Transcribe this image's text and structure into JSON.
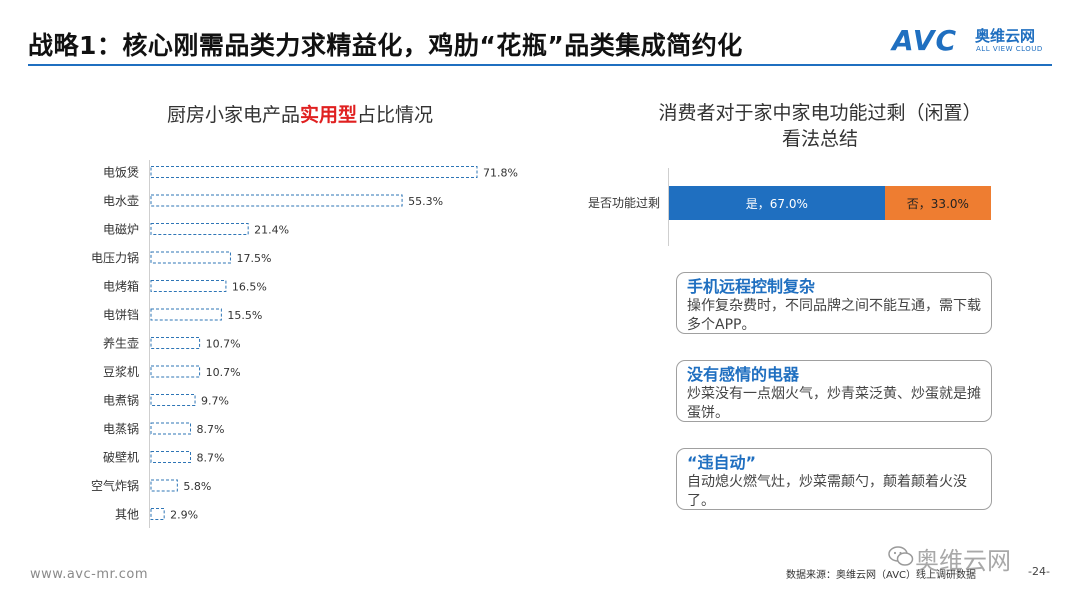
{
  "header": {
    "title": "战略1：核心刚需品类力求精益化，鸡肋“花瓶”品类集成简约化",
    "logo_text": "AVC",
    "logo_cn": "奥维云网",
    "logo_en": "ALL VIEW CLOUD",
    "accent_color": "#1f6fc0"
  },
  "left_chart": {
    "title_pre": "厨房小家电产品",
    "title_highlight": "实用型",
    "title_post": "占比情况"
  },
  "chart_data": [
    {
      "type": "bar",
      "orientation": "horizontal",
      "categories": [
        "电饭煲",
        "电水壶",
        "电磁炉",
        "电压力锅",
        "电烤箱",
        "电饼铛",
        "养生壶",
        "豆浆机",
        "电煮锅",
        "电蒸锅",
        "破壁机",
        "空气炸锅",
        "其他"
      ],
      "values": [
        71.8,
        55.3,
        21.4,
        17.5,
        16.5,
        15.5,
        10.7,
        10.7,
        9.7,
        8.7,
        8.7,
        5.8,
        2.9
      ],
      "value_labels": [
        "71.8%",
        "55.3%",
        "21.4%",
        "17.5%",
        "16.5%",
        "15.5%",
        "10.7%",
        "10.7%",
        "9.7%",
        "8.7%",
        "8.7%",
        "5.8%",
        "2.9%"
      ],
      "bar_style": "dashed-outline",
      "bar_color": "#2e75b6",
      "title": "厨房小家电产品实用型占比情况"
    },
    {
      "type": "bar",
      "orientation": "horizontal-stacked-100",
      "categories": [
        "是否功能过剩"
      ],
      "series": [
        {
          "name": "是",
          "values": [
            67.0
          ],
          "label": "是，67.0%",
          "color": "#1f6fc0"
        },
        {
          "name": "否",
          "values": [
            33.0
          ],
          "label": "否，33.0%",
          "color": "#ee7d31"
        }
      ],
      "title": "消费者对于家中家电功能过剩（闲置）看法总结"
    }
  ],
  "right_panel": {
    "title_line1": "消费者对于家中家电功能过剩（闲置）",
    "title_line2": "看法总结",
    "bar_category": "是否功能过剩",
    "yes_label": "是，67.0%",
    "no_label": "否，33.0%",
    "cards": [
      {
        "title": "手机远程控制复杂",
        "text": "操作复杂费时，不同品牌之间不能互通，需下载多个APP。"
      },
      {
        "title": "没有感情的电器",
        "text": "炒菜没有一点烟火气，炒青菜泛黄、炒蛋就是摊蛋饼。"
      },
      {
        "title": "“违自动”",
        "text": "自动熄火燃气灶，炒菜需颠勺，颠着颠着火没了。"
      }
    ]
  },
  "footer": {
    "website": "www.avc-mr.com",
    "source": "数据来源：奥维云网（AVC）线上调研数据",
    "page": "-24-",
    "watermark": "奥维云网"
  }
}
